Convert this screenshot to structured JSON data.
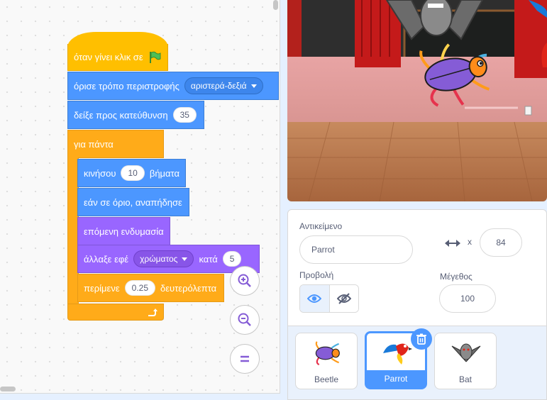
{
  "blocks": {
    "when_flag": "όταν γίνει κλικ σε",
    "rotation_style": "όρισε τρόπο περιστροφής",
    "rotation_value": "αριστερά-δεξιά",
    "point_direction": "δείξε προς κατεύθυνση",
    "direction_value": "35",
    "forever": "για πάντα",
    "move": "κινήσου",
    "move_steps": "10",
    "steps_label": "βήματα",
    "bounce": "εάν σε όριο, αναπήδησε",
    "next_costume": "επόμενη ενδυμασία",
    "change_effect": "άλλαξε εφέ",
    "effect_value": "χρώματος",
    "by_label": "κατά",
    "effect_amount": "5",
    "wait": "περίμενε",
    "wait_value": "0.25",
    "seconds_label": "δευτερόλεπτα"
  },
  "sprite_info": {
    "sprite_label": "Αντικείμενο",
    "sprite_name": "Parrot",
    "x_label": "x",
    "x_value": "84",
    "show_label": "Προβολή",
    "size_label": "Μέγεθος",
    "size_value": "100"
  },
  "sprites": [
    {
      "name": "Beetle",
      "selected": false
    },
    {
      "name": "Parrot",
      "selected": true
    },
    {
      "name": "Bat",
      "selected": false
    }
  ],
  "colors": {
    "events": "#ffbf00",
    "motion": "#4c97ff",
    "looks": "#9966ff",
    "control": "#ffab19",
    "accent": "#855cd6",
    "selected": "#4c97ff"
  }
}
